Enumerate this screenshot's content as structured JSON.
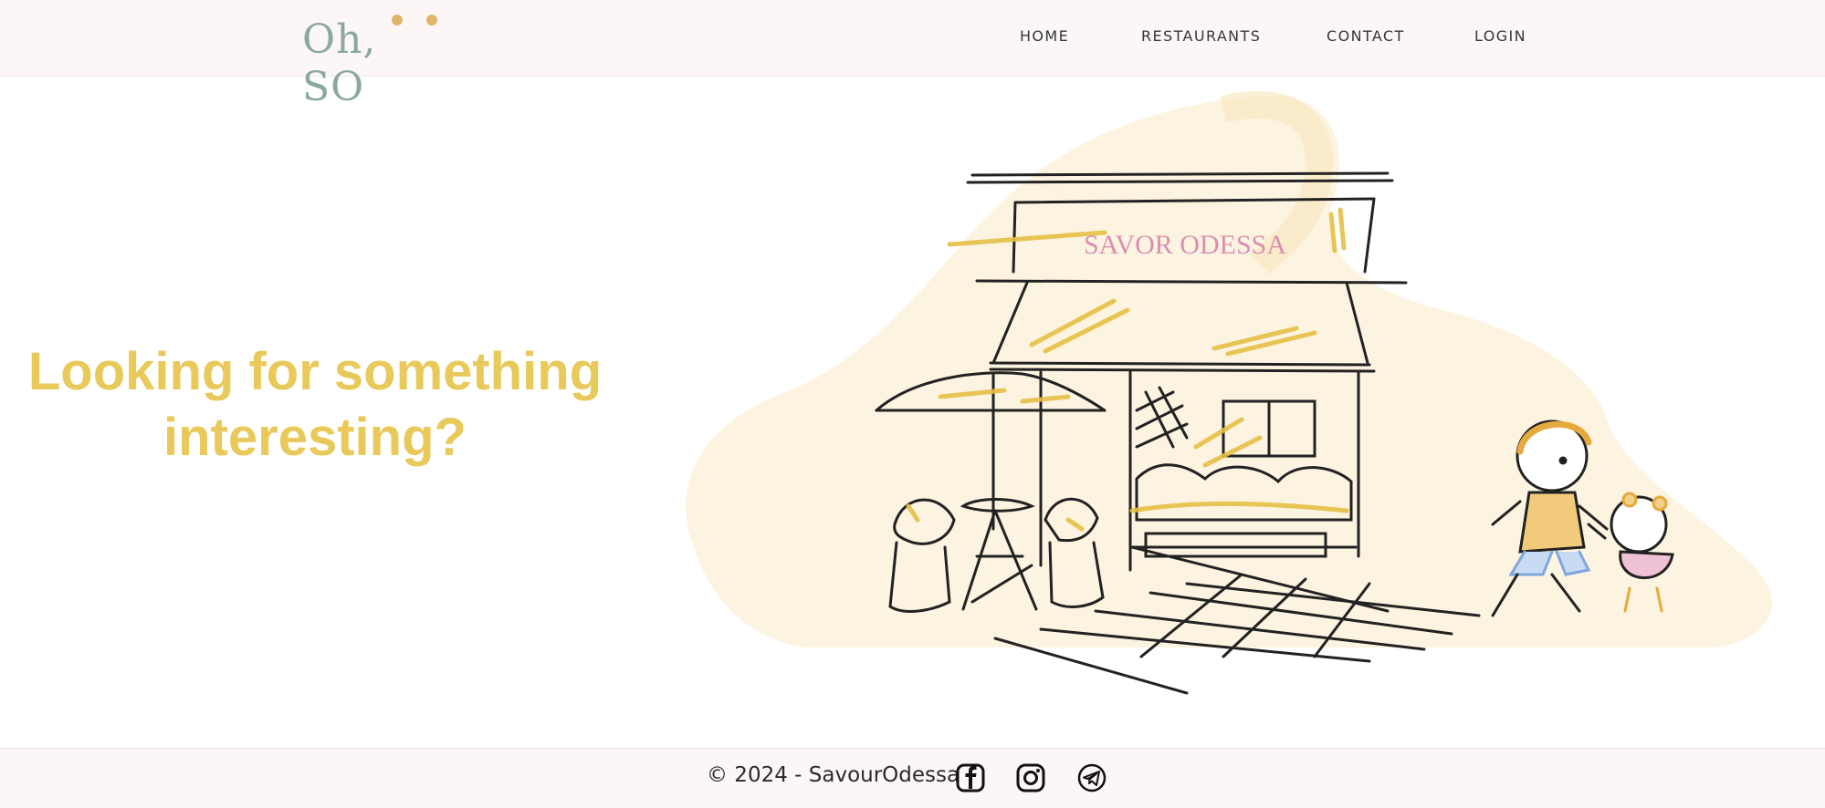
{
  "header": {
    "logo": {
      "text": "Oh, SO",
      "icon": "bear-ears-logo"
    },
    "nav": [
      {
        "label": "HOME"
      },
      {
        "label": "RESTAURANTS"
      },
      {
        "label": "CONTACT"
      },
      {
        "label": "LOGIN"
      }
    ]
  },
  "hero": {
    "title": "Looking for something interesting?",
    "illustration": {
      "sign_text": "SAVOR ODESSA",
      "icon": "cafe-storefront-illustration"
    }
  },
  "footer": {
    "copyright": "© 2024 - SavourOdessa",
    "social": [
      {
        "name": "facebook-icon"
      },
      {
        "name": "instagram-icon"
      },
      {
        "name": "telegram-icon"
      }
    ]
  },
  "colors": {
    "header_bg": "#fdf6f6",
    "accent_yellow": "#e8c95a",
    "logo_green": "#8aa99c",
    "sign_pink": "#d98fb1"
  }
}
